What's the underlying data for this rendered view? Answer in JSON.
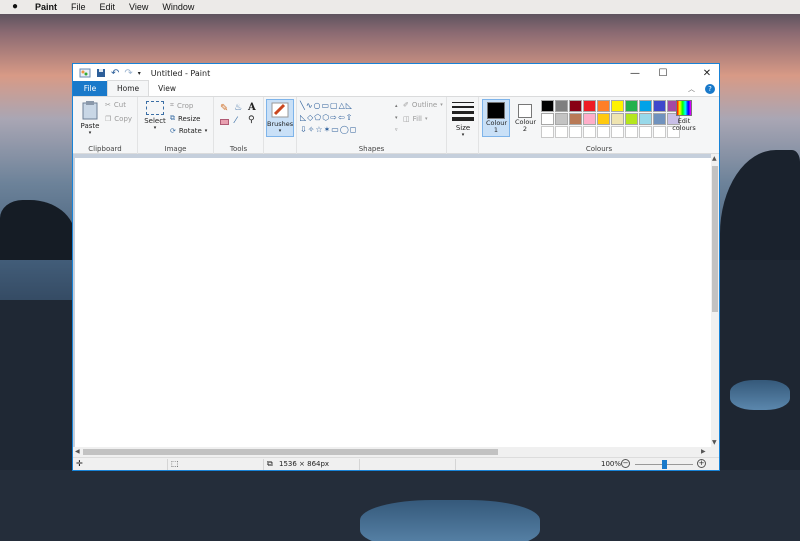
{
  "menubar": {
    "app": "Paint",
    "items": [
      "File",
      "Edit",
      "View",
      "Window"
    ]
  },
  "window": {
    "title": "Untitled - Paint"
  },
  "tabs": [
    "File",
    "Home",
    "View"
  ],
  "ribbon": {
    "clipboard": {
      "paste": "Paste",
      "cut": "Cut",
      "copy": "Copy",
      "group": "Clipboard"
    },
    "image": {
      "select": "Select",
      "crop": "Crop",
      "resize": "Resize",
      "rotate": "Rotate",
      "group": "Image"
    },
    "tools": {
      "group": "Tools"
    },
    "brushes": {
      "label": "Brushes"
    },
    "shapes": {
      "outline": "Outline",
      "fill": "Fill",
      "group": "Shapes"
    },
    "size": {
      "label": "Size"
    },
    "colours": {
      "colour1": "Colour 1",
      "colour2": "Colour 2",
      "edit": "Edit colours",
      "group": "Colours",
      "palette_row1": [
        "#000000",
        "#7f7f7f",
        "#880015",
        "#ed1c24",
        "#ff7f27",
        "#fff200",
        "#22b14c",
        "#00a2e8",
        "#3f48cc",
        "#a349a4"
      ],
      "palette_row2": [
        "#ffffff",
        "#c3c3c3",
        "#b97a57",
        "#ffaec9",
        "#ffc90e",
        "#efe4b0",
        "#b5e61d",
        "#99d9ea",
        "#7092be",
        "#c8bfe7"
      ]
    }
  },
  "status": {
    "dimensions": "1536 × 864px",
    "zoom": "100%",
    "zoom_level": 0.5
  },
  "colors": {
    "accent": "#1979ca"
  }
}
